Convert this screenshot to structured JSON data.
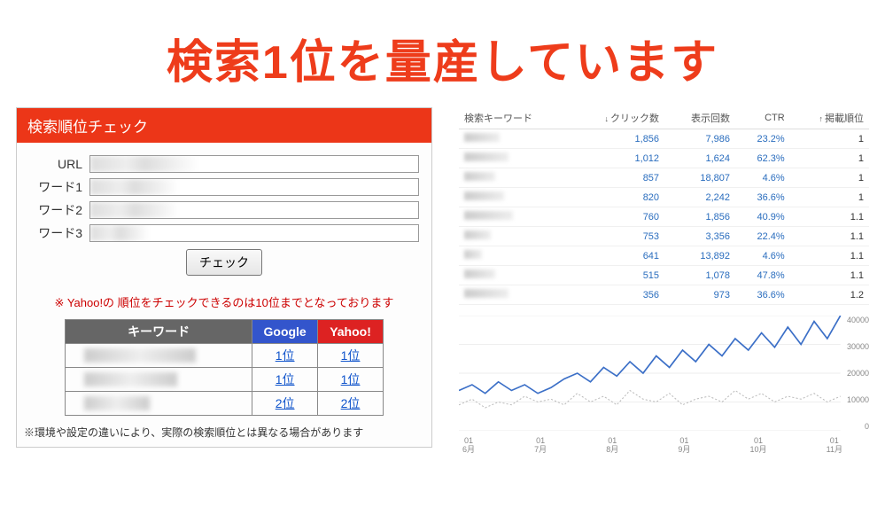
{
  "headline": "検索1位を量産しています",
  "checker": {
    "title": "検索順位チェック",
    "labels": {
      "url": "URL",
      "word1": "ワード1",
      "word2": "ワード2",
      "word3": "ワード3"
    },
    "button": "チェック",
    "note": "※ Yahoo!の 順位をチェックできるのは10位までとなっております",
    "table": {
      "headers": {
        "keyword": "キーワード",
        "google": "Google",
        "yahoo": "Yahoo!"
      },
      "rows": [
        {
          "google": "1位",
          "yahoo": "1位"
        },
        {
          "google": "1位",
          "yahoo": "1位"
        },
        {
          "google": "2位",
          "yahoo": "2位"
        }
      ]
    },
    "footnote": "※環境や設定の違いにより、実際の検索順位とは異なる場合があります"
  },
  "stats": {
    "headers": {
      "keyword": "検索キーワード",
      "clicks": "クリック数",
      "impressions": "表示回数",
      "ctr": "CTR",
      "position": "掲載順位"
    },
    "arrows": {
      "clicks_dir": "↓",
      "position_dir": "↑"
    },
    "rows": [
      {
        "clicks": "1,856",
        "impressions": "7,986",
        "ctr": "23.2%",
        "position": "1"
      },
      {
        "clicks": "1,012",
        "impressions": "1,624",
        "ctr": "62.3%",
        "position": "1"
      },
      {
        "clicks": "857",
        "impressions": "18,807",
        "ctr": "4.6%",
        "position": "1"
      },
      {
        "clicks": "820",
        "impressions": "2,242",
        "ctr": "36.6%",
        "position": "1"
      },
      {
        "clicks": "760",
        "impressions": "1,856",
        "ctr": "40.9%",
        "position": "1.1"
      },
      {
        "clicks": "753",
        "impressions": "3,356",
        "ctr": "22.4%",
        "position": "1.1"
      },
      {
        "clicks": "641",
        "impressions": "13,892",
        "ctr": "4.6%",
        "position": "1.1"
      },
      {
        "clicks": "515",
        "impressions": "1,078",
        "ctr": "47.8%",
        "position": "1.1"
      },
      {
        "clicks": "356",
        "impressions": "973",
        "ctr": "36.6%",
        "position": "1.2"
      }
    ]
  },
  "chart_data": {
    "type": "line",
    "x_ticks": [
      {
        "top": "01",
        "bot": "6月"
      },
      {
        "top": "01",
        "bot": "7月"
      },
      {
        "top": "01",
        "bot": "8月"
      },
      {
        "top": "01",
        "bot": "9月"
      },
      {
        "top": "01",
        "bot": "10月"
      },
      {
        "top": "01",
        "bot": "11月"
      }
    ],
    "y_ticks": [
      "40000",
      "30000",
      "20000",
      "10000",
      "0"
    ],
    "ylim": [
      0,
      40000
    ],
    "series": [
      {
        "name": "impressions",
        "color": "#3b6fc7",
        "values": [
          14000,
          16000,
          13000,
          17000,
          14000,
          16000,
          13000,
          15000,
          18000,
          20000,
          17000,
          22000,
          19000,
          24000,
          20000,
          26000,
          22000,
          28000,
          24000,
          30000,
          26000,
          32000,
          28000,
          34000,
          29000,
          36000,
          30000,
          38000,
          32000,
          40000
        ]
      },
      {
        "name": "clicks",
        "color": "#bbbbbb",
        "dashed": true,
        "values": [
          9000,
          11000,
          8000,
          10000,
          9000,
          12000,
          10000,
          11000,
          9000,
          13000,
          10000,
          12000,
          9000,
          14000,
          11000,
          10000,
          13000,
          9000,
          11000,
          12000,
          10000,
          14000,
          11000,
          13000,
          10000,
          12000,
          11000,
          13000,
          10000,
          12000
        ]
      }
    ]
  }
}
